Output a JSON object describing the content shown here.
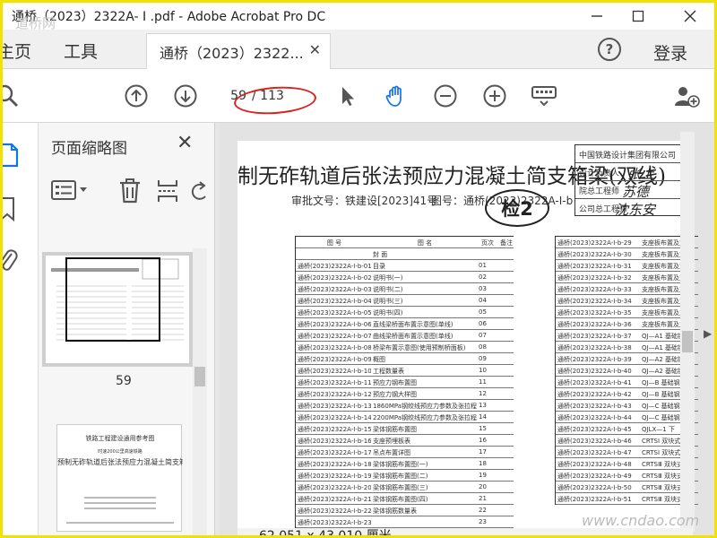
{
  "window": {
    "title": "通桥（2023）2322A- I .pdf - Adobe Acrobat Pro DC"
  },
  "tabs": {
    "home": "主页",
    "tools": "工具",
    "doc": "通桥（2023）2322...",
    "login": "登录",
    "help": "?"
  },
  "toolbar": {
    "page_current": "59",
    "page_total": "/ 113"
  },
  "panel": {
    "title": "页面缩略图",
    "thumb_label": "59",
    "thumb2_lines": [
      "铁路工程建设通用参考图",
      "时速200公里高速铁路",
      "预制无砟轨道后张法预应力混凝土简支箱梁(双线)"
    ]
  },
  "document": {
    "title": "制无砟轨道后张法预应力混凝土简支箱梁(双线)",
    "approval": "审批文号：铁建设[2023]41号",
    "drawing_no": "图号：通桥(2023)2322A-Ⅰ-b",
    "stamp": "检2",
    "company": "中国铁路设计集团有限公司",
    "roles": [
      "设计负责人",
      "院总工程师",
      "公司总工程师"
    ],
    "signatures": [
      "张上",
      "苏德",
      "沈东安"
    ],
    "table_headers": [
      "图 号",
      "图 名",
      "页次",
      "备注"
    ],
    "rows_left": [
      [
        "",
        "封 面",
        "",
        ""
      ],
      [
        "通桥(2023)2322A-Ⅰ-b-01",
        "目录",
        "01",
        ""
      ],
      [
        "通桥(2023)2322A-Ⅰ-b-02",
        "说明书(一)",
        "02",
        ""
      ],
      [
        "通桥(2023)2322A-Ⅰ-b-03",
        "说明书(二)",
        "03",
        ""
      ],
      [
        "通桥(2023)2322A-Ⅰ-b-04",
        "说明书(三)",
        "04",
        ""
      ],
      [
        "通桥(2023)2322A-Ⅰ-b-05",
        "说明书(四)",
        "05",
        ""
      ],
      [
        "通桥(2023)2322A-Ⅰ-b-06",
        "直线梁桥面布置示意图(单线)",
        "06",
        ""
      ],
      [
        "通桥(2023)2322A-Ⅰ-b-07",
        "曲线梁桥面布置示意图(单线)",
        "07",
        ""
      ],
      [
        "通桥(2023)2322A-Ⅰ-b-08",
        "桥梁布置示意图(使用预制桥面板)",
        "08",
        ""
      ],
      [
        "通桥(2023)2322A-Ⅰ-b-09",
        "概图",
        "09",
        ""
      ],
      [
        "通桥(2023)2322A-Ⅰ-b-10",
        "工程数量表",
        "10",
        ""
      ],
      [
        "通桥(2023)2322A-Ⅰ-b-11",
        "预应力钢布置图",
        "11",
        ""
      ],
      [
        "通桥(2023)2322A-Ⅰ-b-12",
        "预应力钢大样图",
        "12",
        ""
      ],
      [
        "通桥(2023)2322A-Ⅰ-b-13",
        "1860MPa钢绞线预应力参数及张拉程序表",
        "13",
        ""
      ],
      [
        "通桥(2023)2322A-Ⅰ-b-14",
        "2200MPa钢绞线预应力参数及张拉程序表",
        "14",
        ""
      ],
      [
        "通桥(2023)2322A-Ⅰ-b-15",
        "梁体钢筋布置图",
        "15",
        ""
      ],
      [
        "通桥(2023)2322A-Ⅰ-b-16",
        "支座预埋板表",
        "16",
        ""
      ],
      [
        "通桥(2023)2322A-Ⅰ-b-17",
        "吊点布置详图",
        "17",
        ""
      ],
      [
        "通桥(2023)2322A-Ⅰ-b-18",
        "梁体钢筋布置图(一)",
        "18",
        ""
      ],
      [
        "通桥(2023)2322A-Ⅰ-b-19",
        "梁体钢筋布置图(二)",
        "19",
        ""
      ],
      [
        "通桥(2023)2322A-Ⅰ-b-20",
        "梁体钢筋布置图(三)",
        "20",
        ""
      ],
      [
        "通桥(2023)2322A-Ⅰ-b-21",
        "梁体钢筋布置图(四)",
        "21",
        ""
      ],
      [
        "通桥(2023)2322A-Ⅰ-b-22",
        "梁体钢筋数量表",
        "22",
        ""
      ],
      [
        "通桥(2023)2322A-Ⅰ-b-23",
        "",
        "23",
        ""
      ]
    ],
    "rows_right": [
      [
        "通桥(2023)2322A-Ⅰ-b-29",
        "支座板布置及支"
      ],
      [
        "通桥(2023)2322A-Ⅰ-b-30",
        "支座板布置及支"
      ],
      [
        "通桥(2023)2322A-Ⅰ-b-31",
        "支座板布置及支"
      ],
      [
        "通桥(2023)2322A-Ⅰ-b-32",
        "支座板布置及支"
      ],
      [
        "通桥(2023)2322A-Ⅰ-b-33",
        "支座板布置及支"
      ],
      [
        "通桥(2023)2322A-Ⅰ-b-34",
        "支座板布置及支"
      ],
      [
        "通桥(2023)2322A-Ⅰ-b-35",
        "支座板布置及支"
      ],
      [
        "通桥(2023)2322A-Ⅰ-b-36",
        "支座板布置及支"
      ],
      [
        "通桥(2023)2322A-Ⅰ-b-37",
        "QJ—A1 基础钢"
      ],
      [
        "通桥(2023)2322A-Ⅰ-b-38",
        "QJ—A1 基础钢"
      ],
      [
        "通桥(2023)2322A-Ⅰ-b-39",
        "QJ—A2 基础钢"
      ],
      [
        "通桥(2023)2322A-Ⅰ-b-40",
        "QJ—A2 基础钢"
      ],
      [
        "通桥(2023)2322A-Ⅰ-b-41",
        "QJ—B 基础钢"
      ],
      [
        "通桥(2023)2322A-Ⅰ-b-42",
        "QJ—B 基础钢"
      ],
      [
        "通桥(2023)2322A-Ⅰ-b-43",
        "QJ—C 基础钢"
      ],
      [
        "通桥(2023)2322A-Ⅰ-b-44",
        "QJ—C 基础钢"
      ],
      [
        "通桥(2023)2322A-Ⅰ-b-45",
        "QJLX—1 下"
      ],
      [
        "通桥(2023)2322A-Ⅰ-b-46",
        "CRTSⅠ 双块式"
      ],
      [
        "通桥(2023)2322A-Ⅰ-b-47",
        "CRTSⅠ 双块式"
      ],
      [
        "通桥(2023)2322A-Ⅰ-b-48",
        "CRTSⅢ 双块式"
      ],
      [
        "通桥(2023)2322A-Ⅰ-b-49",
        "CRTSⅢ 双块式"
      ],
      [
        "通桥(2023)2322A-Ⅰ-b-50",
        "CRTSⅢ 双块式"
      ],
      [
        "通桥(2023)2322A-Ⅰ-b-51",
        "CRTSⅢ 双块式"
      ]
    ]
  },
  "status": {
    "page_size": "62.051 x 43.010 厘米"
  },
  "watermarks": {
    "top": "道桥网",
    "bottom": "www.cndao.com"
  }
}
